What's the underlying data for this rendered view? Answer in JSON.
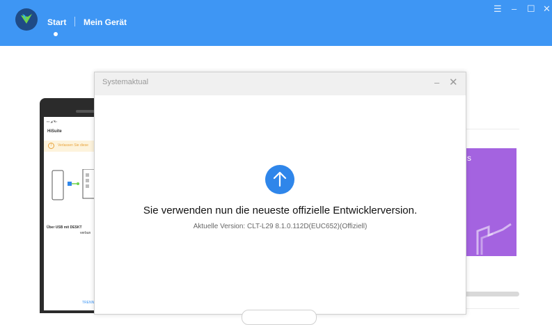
{
  "header": {
    "nav": {
      "start": "Start",
      "device": "Mein Gerät"
    },
    "window_controls": {
      "menu": "☰",
      "minimize": "–",
      "maximize": "☐",
      "close": "✕"
    }
  },
  "phone": {
    "title": "HiSuite",
    "warning": "Verlassen Sie diese",
    "usb_text": "Über USB mit DESKT",
    "usb_text2": "verbun",
    "link": "TRENN"
  },
  "right_panel": {
    "card_text": "s"
  },
  "dialog": {
    "title": "Systemaktual",
    "message": "Sie verwenden nun die neueste offizielle Entwicklerversion.",
    "version": "Aktuelle Version: CLT-L29 8.1.0.112D(EUC652)(Offiziell)"
  }
}
